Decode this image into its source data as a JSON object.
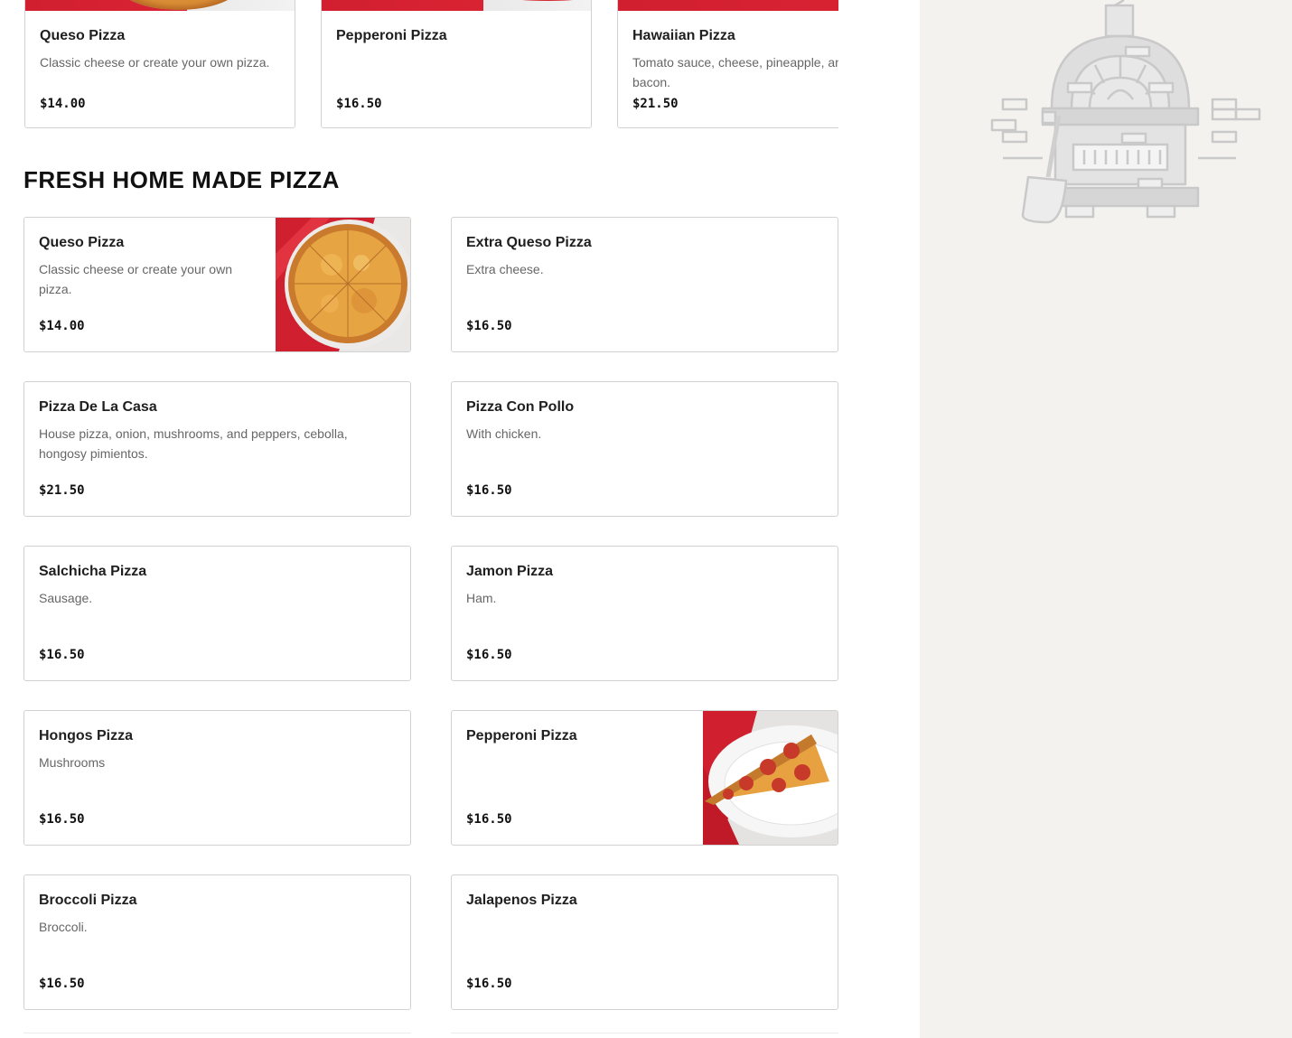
{
  "featured": [
    {
      "name": "Queso Pizza",
      "description": "Classic cheese or create your own pizza.",
      "price": "$14.00"
    },
    {
      "name": "Pepperoni Pizza",
      "description": "",
      "price": "$16.50"
    },
    {
      "name": "Hawaiian Pizza",
      "description": "Tomato sauce, cheese, pineapple, and bacon.",
      "price": "$21.50"
    }
  ],
  "section": {
    "title": "FRESH HOME MADE PIZZA",
    "items": [
      {
        "name": "Queso Pizza",
        "description": "Classic cheese or create your own pizza.",
        "price": "$14.00",
        "image": "cheese-pizza-photo"
      },
      {
        "name": "Extra Queso Pizza",
        "description": "Extra cheese.",
        "price": "$16.50"
      },
      {
        "name": "Pizza De La Casa",
        "description": "House pizza, onion, mushrooms, and peppers, cebolla, hongosy pimientos.",
        "price": "$21.50"
      },
      {
        "name": "Pizza Con Pollo",
        "description": "With chicken.",
        "price": "$16.50"
      },
      {
        "name": "Salchicha Pizza",
        "description": "Sausage.",
        "price": "$16.50"
      },
      {
        "name": "Jamon Pizza",
        "description": "Ham.",
        "price": "$16.50"
      },
      {
        "name": "Hongos Pizza",
        "description": "Mushrooms",
        "price": "$16.50"
      },
      {
        "name": "Pepperoni Pizza",
        "description": "",
        "price": "$16.50",
        "image": "pepperoni-slice-photo"
      },
      {
        "name": "Broccoli Pizza",
        "description": "Broccoli.",
        "price": "$16.50"
      },
      {
        "name": "Jalapenos Pizza",
        "description": "",
        "price": "$16.50"
      }
    ]
  },
  "sidebar": {
    "illustration": "pizza-oven-icon"
  },
  "colors": {
    "accent_red": "#d11f2f",
    "sidebar_bg": "#f3f2ef",
    "border": "#d2d2d2"
  }
}
